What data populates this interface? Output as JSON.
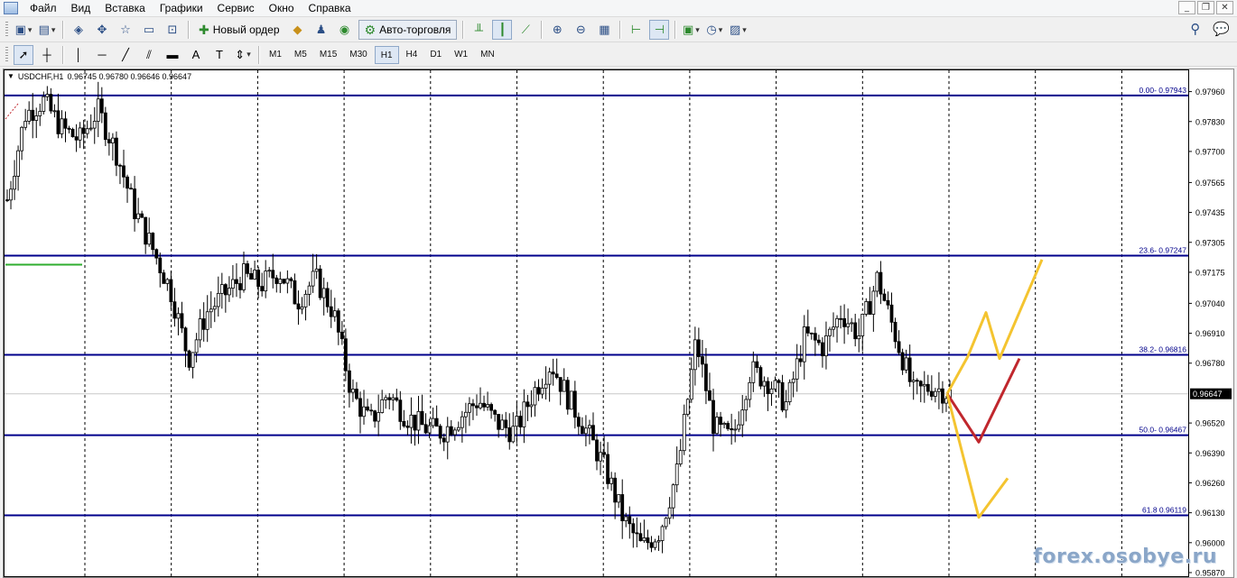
{
  "menu": {
    "items": [
      "Файл",
      "Вид",
      "Вставка",
      "Графики",
      "Сервис",
      "Окно",
      "Справка"
    ],
    "window_controls": [
      "_",
      "❐",
      "✕"
    ]
  },
  "toolbar1": {
    "new_order_label": "Новый ордер",
    "autotrading_label": "Авто-торговля",
    "icons": [
      "new-chart-icon",
      "profiles-icon",
      "market-watch-icon",
      "navigator-icon",
      "favorites-icon",
      "terminal-icon",
      "tester-icon",
      "new-order-icon",
      "gold-icon",
      "alerts-icon",
      "signal-icon",
      "bar-chart-icon",
      "candlestick-icon",
      "line-chart-icon",
      "zoom-in-icon",
      "zoom-out-icon",
      "tile-windows-icon",
      "chart-shift-icon",
      "autoscroll-icon",
      "indicators-icon",
      "periods-icon",
      "templates-icon",
      "search-icon",
      "chat-icon"
    ]
  },
  "toolbar2": {
    "timeframes": [
      "M1",
      "M5",
      "M15",
      "M30",
      "H1",
      "H4",
      "D1",
      "W1",
      "MN"
    ],
    "active_timeframe": "H1",
    "tool_icons": [
      "cursor-icon",
      "crosshair-icon",
      "vertical-line-icon",
      "horizontal-line-icon",
      "trendline-icon",
      "channel-icon",
      "shapes-icon",
      "text-icon",
      "text-label-icon",
      "arrows-icon"
    ]
  },
  "chart": {
    "symbol": "USDCHF,H1",
    "ohlc": "0.96745 0.96780 0.96646 0.96647",
    "current_price": "0.96647",
    "watermark": "forex.osobye.ru",
    "colors": {
      "fib_level": "#00008b",
      "candle": "#000000",
      "bull_body": "#ffffff",
      "price_line": "#c8c8c8",
      "forecast_yellow": "#f4c430",
      "forecast_red": "#c0272d",
      "green_segment": "#2fae2f",
      "grid": "#000000",
      "current_price_bg": "#000000"
    }
  },
  "chart_data": {
    "type": "candlestick",
    "symbol": "USDCHF",
    "timeframe": "H1",
    "ylim": [
      0.9587,
      0.98025
    ],
    "y_ticks": [
      "0.97960",
      "0.97830",
      "0.97700",
      "0.97565",
      "0.97435",
      "0.97305",
      "0.97175",
      "0.97040",
      "0.96910",
      "0.96780",
      "0.96520",
      "0.96390",
      "0.96260",
      "0.96130",
      "0.96000",
      "0.95870"
    ],
    "fib_levels": [
      {
        "label": "0.00- 0.97943",
        "price": 0.97943
      },
      {
        "label": "23.6- 0.97247",
        "price": 0.97247
      },
      {
        "label": "38.2- 0.96816",
        "price": 0.96816
      },
      {
        "label": "50.0- 0.96467",
        "price": 0.96467
      },
      {
        "label": "61.8 0.96119",
        "price": 0.96119
      }
    ],
    "key_prices": [
      0.9749,
      0.9786,
      0.9792,
      0.978,
      0.9775,
      0.9788,
      0.977,
      0.9745,
      0.9728,
      0.971,
      0.968,
      0.97,
      0.9708,
      0.9716,
      0.9712,
      0.9718,
      0.9705,
      0.9715,
      0.97,
      0.9665,
      0.9652,
      0.9665,
      0.9655,
      0.965,
      0.9648,
      0.9655,
      0.9662,
      0.9652,
      0.9648,
      0.9665,
      0.9678,
      0.9662,
      0.9648,
      0.9632,
      0.961,
      0.9598,
      0.9605,
      0.9632,
      0.9688,
      0.965,
      0.9645,
      0.9675,
      0.967,
      0.966,
      0.969,
      0.9685,
      0.97,
      0.969,
      0.9715,
      0.969,
      0.9665,
      0.9668,
      0.96647
    ],
    "forecast": {
      "yellow_up": [
        0.96647,
        0.9681,
        0.97,
        0.968,
        0.9723
      ],
      "red": [
        0.96647,
        0.96437,
        0.968
      ],
      "yellow_down": [
        0.96647,
        0.9611,
        0.9628
      ]
    }
  }
}
